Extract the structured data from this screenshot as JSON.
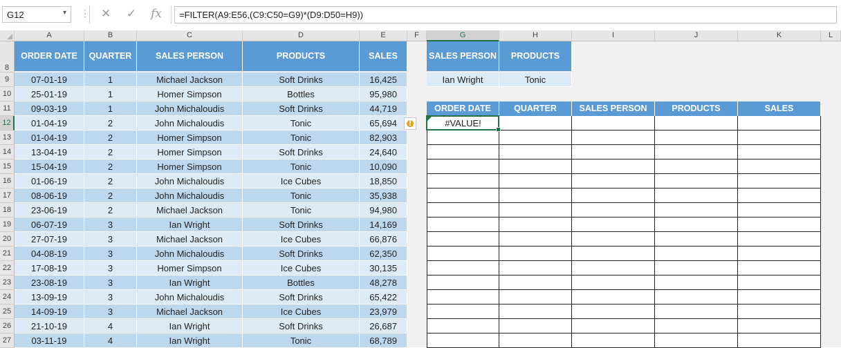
{
  "formula_bar": {
    "name_box": "G12",
    "name_box_arrow": "▾",
    "dots": "⋮",
    "cancel_glyph": "✕",
    "enter_glyph": "✓",
    "fx_label": "fx",
    "formula": "=FILTER(A9:E56,(C9:C50=G9)*(D9:D50=H9))"
  },
  "columns": [
    "A",
    "B",
    "C",
    "D",
    "E",
    "F",
    "G",
    "H",
    "I",
    "J",
    "K",
    "L"
  ],
  "selected_column": "G",
  "row_numbers": [
    "8",
    "9",
    "10",
    "11",
    "12",
    "13",
    "14",
    "15",
    "16",
    "17",
    "18",
    "19",
    "20",
    "21",
    "22",
    "23",
    "24",
    "25",
    "26",
    "27"
  ],
  "selected_row": "12",
  "source_table": {
    "headers": [
      "ORDER DATE",
      "QUARTER",
      "SALES PERSON",
      "PRODUCTS",
      "SALES"
    ],
    "rows": [
      [
        "07-01-19",
        "1",
        "Michael Jackson",
        "Soft Drinks",
        "16,425"
      ],
      [
        "25-01-19",
        "1",
        "Homer Simpson",
        "Bottles",
        "95,980"
      ],
      [
        "09-03-19",
        "1",
        "John Michaloudis",
        "Soft Drinks",
        "44,719"
      ],
      [
        "01-04-19",
        "2",
        "John Michaloudis",
        "Tonic",
        "65,694"
      ],
      [
        "01-04-19",
        "2",
        "Homer Simpson",
        "Tonic",
        "82,903"
      ],
      [
        "13-04-19",
        "2",
        "Homer Simpson",
        "Soft Drinks",
        "24,640"
      ],
      [
        "15-04-19",
        "2",
        "Homer Simpson",
        "Tonic",
        "10,090"
      ],
      [
        "01-06-19",
        "2",
        "John Michaloudis",
        "Ice Cubes",
        "18,850"
      ],
      [
        "08-06-19",
        "2",
        "John Michaloudis",
        "Tonic",
        "35,938"
      ],
      [
        "23-06-19",
        "2",
        "Michael Jackson",
        "Tonic",
        "94,980"
      ],
      [
        "06-07-19",
        "3",
        "Ian Wright",
        "Soft Drinks",
        "14,169"
      ],
      [
        "27-07-19",
        "3",
        "Michael Jackson",
        "Ice Cubes",
        "66,876"
      ],
      [
        "04-08-19",
        "3",
        "John Michaloudis",
        "Soft Drinks",
        "62,350"
      ],
      [
        "17-08-19",
        "3",
        "Homer Simpson",
        "Ice Cubes",
        "30,135"
      ],
      [
        "23-08-19",
        "3",
        "Ian Wright",
        "Bottles",
        "48,278"
      ],
      [
        "13-09-19",
        "3",
        "John Michaloudis",
        "Soft Drinks",
        "65,422"
      ],
      [
        "14-09-19",
        "3",
        "Michael Jackson",
        "Ice Cubes",
        "23,979"
      ],
      [
        "21-10-19",
        "4",
        "Ian Wright",
        "Soft Drinks",
        "26,687"
      ],
      [
        "03-11-19",
        "4",
        "Ian Wright",
        "Tonic",
        "68,789"
      ]
    ]
  },
  "criteria": {
    "headers": [
      "SALES PERSON",
      "PRODUCTS"
    ],
    "values": [
      "Ian Wright",
      "Tonic"
    ]
  },
  "output_table": {
    "headers": [
      "ORDER DATE",
      "QUARTER",
      "SALES PERSON",
      "PRODUCTS",
      "SALES"
    ],
    "result": "#VALUE!"
  },
  "warning_glyph": "!",
  "colors": {
    "header_blue": "#5b9bd5",
    "band_dark": "#bdd7ee",
    "band_light": "#ddebf7",
    "selection_green": "#217346"
  }
}
